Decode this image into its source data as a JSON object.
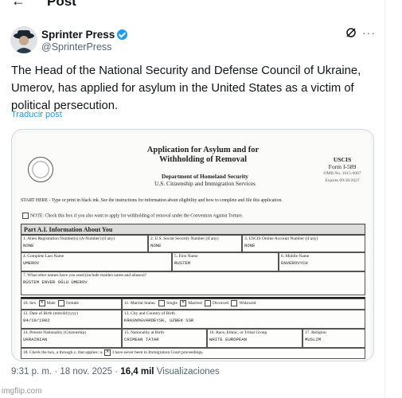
{
  "header": {
    "back_icon": "arrow-left-icon",
    "title": "Post"
  },
  "author": {
    "name": "Sprinter Press",
    "handle": "@SprinterPress",
    "verified": true
  },
  "tweet": {
    "text": "The Head of the National Security and Defense Council of Ukraine, Umerov, has applied for asylum in the United States as a victim of political persecution.",
    "translate_label": "Traducir post"
  },
  "form": {
    "title": "Application for Asylum and for Withholding of Removal",
    "dept": "Department of Homeland Security",
    "agency": "U.S. Citizenship and Immigration Services",
    "uscis": "USCIS",
    "form_no": "Form I-589",
    "omb": "OMB No. 1615-0067",
    "expires": "Expires 09/30/2027",
    "start_here": "START HERE - Type or print in black ink. See the instructions for information about eligibility and how to complete and file this application.",
    "note": "NOTE: Check this box if you also want to apply for withholding of removal under the Convention Against Torture.",
    "part_title": "Part A.I. Information About You",
    "f1_label": "1. Alien Registration Number(s) (A-Number) (if any)",
    "f1_value": "NONE",
    "f2_label": "2. U.S. Social Security Number (if any)",
    "f2_value": "NONE",
    "f3_label": "3. USCIS Online Account Number (if any)",
    "f3_value": "NONE",
    "f4_label": "4. Complete Last Name",
    "f4_value": "UMEROV",
    "f5_label": "5. First Name",
    "f5_value": "RUSTEM",
    "f6_label": "6. Middle Name",
    "f6_value": "ENVEROVYCH",
    "f7_label": "7. What other names have you used (include maiden name and aliases)?",
    "f7_value": "RÜSTEM ENVER OĞLU ÜMEROV",
    "f10_label": "10. Sex",
    "f10_male": "Male",
    "f10_female": "Female",
    "f11_label": "11. Marital Status:",
    "f11_single": "Single",
    "f11_married": "Married",
    "f11_divorced": "Divorced",
    "f11_widowed": "Widowed",
    "f12_label": "12. Date of Birth (mm/dd/yyyy)",
    "f12_value": "04/19/1982",
    "f13_label": "13. City and Country of Birth",
    "f13_value": "KRASNOGVARDEYSK, UZBEK SSR",
    "f14_label": "14. Present Nationality (Citizenship)",
    "f14_value": "UKRAINIAN",
    "f15_label": "15. Nationality at Birth",
    "f15_value": "CRIMEAN TATAR",
    "f16_label": "16. Race, Ethnic, or Tribal Group",
    "f16_value": "WHITE EUROPEAN",
    "f17_label": "17. Religion",
    "f17_value": "MUSLIM",
    "f18_label": "18. Check the box, a through c, that applies:",
    "f18_a": "a.",
    "f18_a_text": "I have never been in Immigration Court proceedings."
  },
  "footer": {
    "time": "9:31 p. m.",
    "sep1": "·",
    "date": "18 nov. 2025",
    "sep2": "·",
    "views": "16,4 mil",
    "views_label": "Visualizaciones"
  },
  "watermark": "imgflip.com"
}
